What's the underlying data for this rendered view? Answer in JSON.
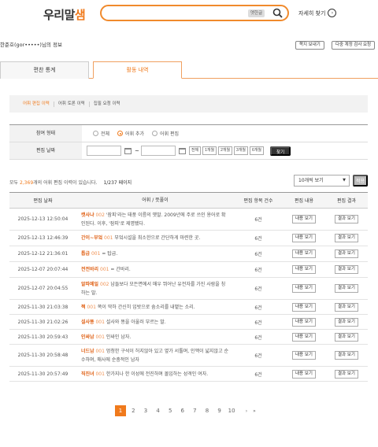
{
  "header": {
    "logo_main": "우리말",
    "logo_accent": "샘",
    "search_tag": "옛한글",
    "advanced_search": "자세히 찾기"
  },
  "user": {
    "info": "한준호(gor•••••)님의 정보",
    "buttons": [
      "쪽지 보내기",
      "다중 계정 검사 요청"
    ]
  },
  "tabs": [
    {
      "label": "편찬 통계",
      "active": false
    },
    {
      "label": "활동 내역",
      "active": true
    }
  ],
  "subtabs": [
    {
      "label": "어휘 편집 이력",
      "active": true
    },
    {
      "label": "어휘 토론 이력",
      "active": false
    },
    {
      "label": "집필 요청 이력",
      "active": false
    }
  ],
  "filter": {
    "type_label": "참여 형태",
    "type_options": [
      {
        "label": "전체",
        "selected": false
      },
      {
        "label": "어휘 추가",
        "selected": true
      },
      {
        "label": "어휘 편집",
        "selected": false
      }
    ],
    "date_label": "편집 날짜",
    "date_sep": "~",
    "periods": [
      "전체",
      "1개월",
      "2개월",
      "3개월",
      "6개월"
    ],
    "find": "찾기"
  },
  "summary": {
    "prefix": "모두 ",
    "count": "2,369",
    "suffix": "개의 어휘 편집 이력이 있습니다.",
    "page": "1/237 페이지",
    "page_size": "10개씩 보기",
    "apply": "적용"
  },
  "table": {
    "headers": [
      "편집 날짜",
      "어휘 / 뜻풀이",
      "편집 항목 건수",
      "편집 내용",
      "편집 결과"
    ],
    "view_label": "내용 보기",
    "result_label": "결과 보기",
    "rows": [
      {
        "date": "2025-12-13 12:50:04",
        "word": "캣사냐",
        "sense": "002",
        "def": "'잠피'라는 태풍 이름의 옛말. 2009년에 주로 쓰인 용어로 확인된다. 이후, '잠피'로 제명됐다.",
        "count": "6건"
      },
      {
        "date": "2025-12-13 12:46:39",
        "word": "간이~부엌",
        "sense": "001",
        "def": "부엌시설을 최소한으로 간단하게 마련한 곳.",
        "count": "6건"
      },
      {
        "date": "2025-12-12 21:36:01",
        "word": "톱급",
        "sense": "001",
        "def": "= 탑급.",
        "count": "6건"
      },
      {
        "date": "2025-12-07 20:07:44",
        "word": "전전바리",
        "sense": "001",
        "def": "= 간바리.",
        "count": "6건"
      },
      {
        "date": "2025-12-07 20:04:55",
        "word": "알파메일",
        "sense": "002",
        "def": "남들보다 모든면에서 매우 뛰어난 유전자를 가진 사람을 칭하는 말.",
        "count": "6건"
      },
      {
        "date": "2025-11-30 21:03:38",
        "word": "쩍",
        "sense": "001",
        "def": "쪽이 딱하 간신히 입밧으로 숨소리를 내뱉는 소리.",
        "count": "6건"
      },
      {
        "date": "2025-11-30 21:02:26",
        "word": "설사똥",
        "sense": "001",
        "def": "설사와 똥을 아울러 부르는 말.",
        "count": "6건"
      },
      {
        "date": "2025-11-30 20:59:43",
        "word": "인싸남",
        "sense": "001",
        "def": "인싸인 남자.",
        "count": "6건"
      },
      {
        "date": "2025-11-30 20:58:48",
        "word": "너드남",
        "sense": "001",
        "def": "멍청한 구석이 허지않아 있고 옆가 서툴며, 인맥이 넓지않고 순수하며, 매사에 순충적인 남자",
        "count": "6건"
      },
      {
        "date": "2025-11-30 20:57:49",
        "word": "직진녀",
        "sense": "001",
        "def": "한가지나 한 이성에 전진하며 몰입하는 성격인 여자.",
        "count": "6건"
      }
    ]
  },
  "pagination": {
    "pages": [
      "1",
      "2",
      "3",
      "4",
      "5",
      "6",
      "7",
      "8",
      "9",
      "10"
    ],
    "current": "1",
    "next": "›",
    "last": "»"
  }
}
